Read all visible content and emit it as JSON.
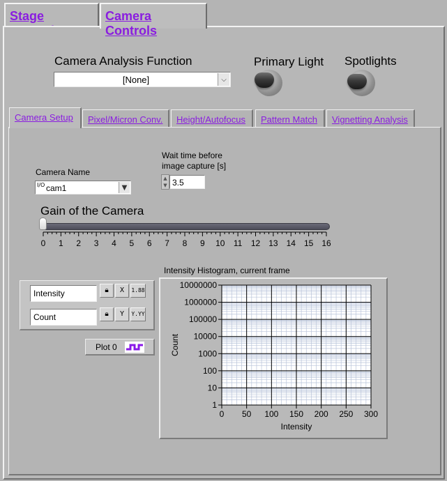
{
  "top_tabs": [
    {
      "label": "Stage Controls",
      "active": false
    },
    {
      "label": "Camera Controls",
      "active": true
    }
  ],
  "camera_analysis": {
    "label": "Camera Analysis Function",
    "value": "[None]"
  },
  "switches": {
    "primary_light": "Primary Light",
    "spotlights": "Spotlights"
  },
  "inner_tabs": [
    {
      "label": "Camera Setup",
      "active": true
    },
    {
      "label": "Pixel/Micron Conv.",
      "active": false
    },
    {
      "label": "Height/Autofocus",
      "active": false
    },
    {
      "label": "Pattern Match",
      "active": false
    },
    {
      "label": "Vignetting Analysis",
      "active": false
    }
  ],
  "camera_name": {
    "label": "Camera Name",
    "prefix": "I/O",
    "value": "cam1"
  },
  "wait_time": {
    "label_line1": "Wait time before",
    "label_line2": "image capture [s]",
    "value": "3.5"
  },
  "gain": {
    "label": "Gain of the Camera",
    "value": 0,
    "min": 0,
    "max": 16,
    "ticks": [
      "0",
      "1",
      "2",
      "3",
      "4",
      "5",
      "6",
      "7",
      "8",
      "9",
      "10",
      "11",
      "12",
      "13",
      "14",
      "15",
      "16"
    ]
  },
  "scale_legend": {
    "x_name": "Intensity",
    "y_name": "Count",
    "x_btn": "X",
    "y_btn": "Y",
    "x_fmt": "1.88",
    "y_fmt": "Y.YY"
  },
  "plot_legend": {
    "label": "Plot 0"
  },
  "colors": {
    "tab_text": "#8a1de0",
    "plot_swatch": "#8a18e8",
    "panel_bg": "#b4b4b4"
  },
  "chart_data": {
    "type": "line",
    "title": "Intensity Histogram, current frame",
    "xlabel": "Intensity",
    "ylabel": "Count",
    "xlim": [
      0,
      300
    ],
    "ylim": [
      1,
      10000000
    ],
    "y_scale": "log",
    "x_ticks": [
      "0",
      "50",
      "100",
      "150",
      "200",
      "250",
      "300"
    ],
    "y_ticks": [
      "1",
      "10",
      "100",
      "1000",
      "10000",
      "100000",
      "1000000",
      "10000000"
    ],
    "grid": true,
    "series": []
  }
}
